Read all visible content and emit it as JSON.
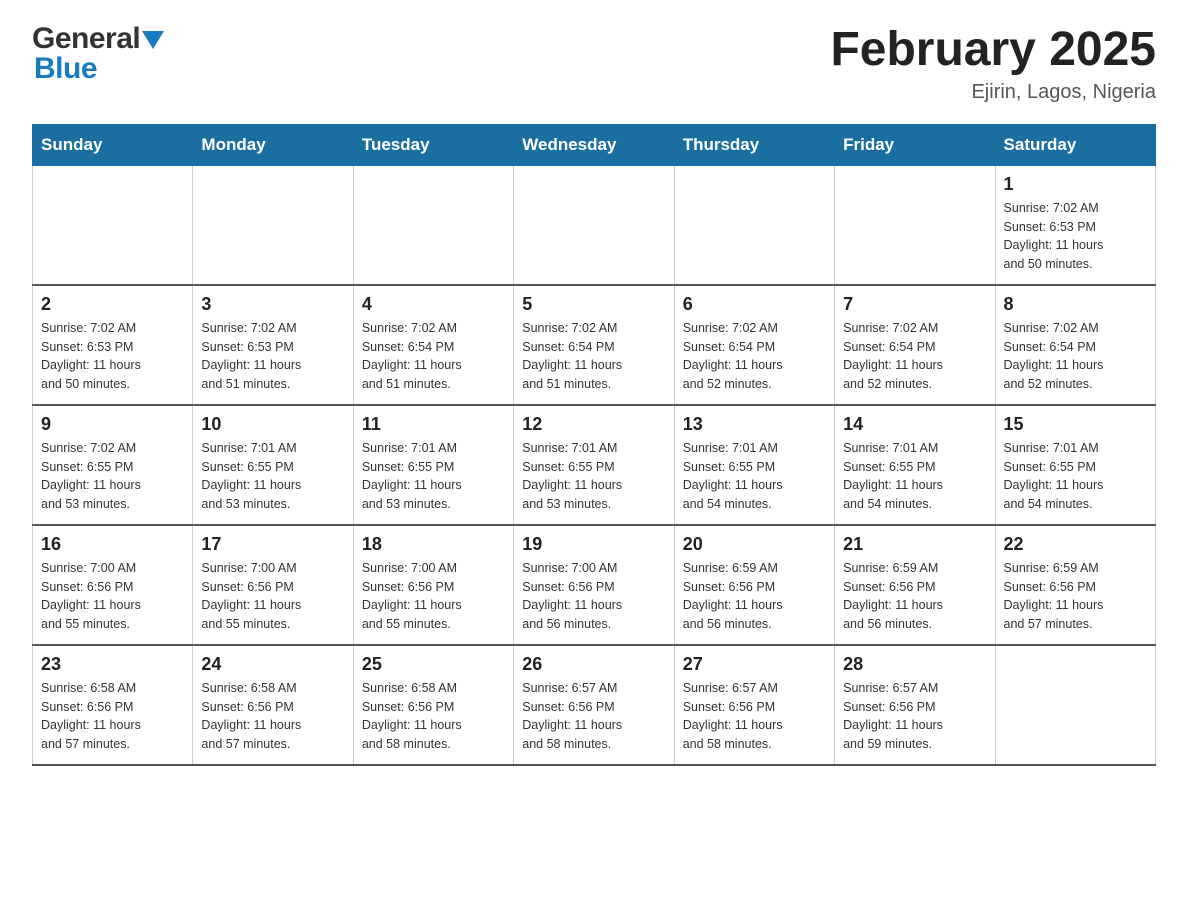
{
  "header": {
    "logo_general": "General",
    "logo_blue": "Blue",
    "month_title": "February 2025",
    "location": "Ejirin, Lagos, Nigeria"
  },
  "calendar": {
    "days_of_week": [
      "Sunday",
      "Monday",
      "Tuesday",
      "Wednesday",
      "Thursday",
      "Friday",
      "Saturday"
    ],
    "weeks": [
      {
        "days": [
          {
            "number": "",
            "info": ""
          },
          {
            "number": "",
            "info": ""
          },
          {
            "number": "",
            "info": ""
          },
          {
            "number": "",
            "info": ""
          },
          {
            "number": "",
            "info": ""
          },
          {
            "number": "",
            "info": ""
          },
          {
            "number": "1",
            "info": "Sunrise: 7:02 AM\nSunset: 6:53 PM\nDaylight: 11 hours\nand 50 minutes."
          }
        ]
      },
      {
        "days": [
          {
            "number": "2",
            "info": "Sunrise: 7:02 AM\nSunset: 6:53 PM\nDaylight: 11 hours\nand 50 minutes."
          },
          {
            "number": "3",
            "info": "Sunrise: 7:02 AM\nSunset: 6:53 PM\nDaylight: 11 hours\nand 51 minutes."
          },
          {
            "number": "4",
            "info": "Sunrise: 7:02 AM\nSunset: 6:54 PM\nDaylight: 11 hours\nand 51 minutes."
          },
          {
            "number": "5",
            "info": "Sunrise: 7:02 AM\nSunset: 6:54 PM\nDaylight: 11 hours\nand 51 minutes."
          },
          {
            "number": "6",
            "info": "Sunrise: 7:02 AM\nSunset: 6:54 PM\nDaylight: 11 hours\nand 52 minutes."
          },
          {
            "number": "7",
            "info": "Sunrise: 7:02 AM\nSunset: 6:54 PM\nDaylight: 11 hours\nand 52 minutes."
          },
          {
            "number": "8",
            "info": "Sunrise: 7:02 AM\nSunset: 6:54 PM\nDaylight: 11 hours\nand 52 minutes."
          }
        ]
      },
      {
        "days": [
          {
            "number": "9",
            "info": "Sunrise: 7:02 AM\nSunset: 6:55 PM\nDaylight: 11 hours\nand 53 minutes."
          },
          {
            "number": "10",
            "info": "Sunrise: 7:01 AM\nSunset: 6:55 PM\nDaylight: 11 hours\nand 53 minutes."
          },
          {
            "number": "11",
            "info": "Sunrise: 7:01 AM\nSunset: 6:55 PM\nDaylight: 11 hours\nand 53 minutes."
          },
          {
            "number": "12",
            "info": "Sunrise: 7:01 AM\nSunset: 6:55 PM\nDaylight: 11 hours\nand 53 minutes."
          },
          {
            "number": "13",
            "info": "Sunrise: 7:01 AM\nSunset: 6:55 PM\nDaylight: 11 hours\nand 54 minutes."
          },
          {
            "number": "14",
            "info": "Sunrise: 7:01 AM\nSunset: 6:55 PM\nDaylight: 11 hours\nand 54 minutes."
          },
          {
            "number": "15",
            "info": "Sunrise: 7:01 AM\nSunset: 6:55 PM\nDaylight: 11 hours\nand 54 minutes."
          }
        ]
      },
      {
        "days": [
          {
            "number": "16",
            "info": "Sunrise: 7:00 AM\nSunset: 6:56 PM\nDaylight: 11 hours\nand 55 minutes."
          },
          {
            "number": "17",
            "info": "Sunrise: 7:00 AM\nSunset: 6:56 PM\nDaylight: 11 hours\nand 55 minutes."
          },
          {
            "number": "18",
            "info": "Sunrise: 7:00 AM\nSunset: 6:56 PM\nDaylight: 11 hours\nand 55 minutes."
          },
          {
            "number": "19",
            "info": "Sunrise: 7:00 AM\nSunset: 6:56 PM\nDaylight: 11 hours\nand 56 minutes."
          },
          {
            "number": "20",
            "info": "Sunrise: 6:59 AM\nSunset: 6:56 PM\nDaylight: 11 hours\nand 56 minutes."
          },
          {
            "number": "21",
            "info": "Sunrise: 6:59 AM\nSunset: 6:56 PM\nDaylight: 11 hours\nand 56 minutes."
          },
          {
            "number": "22",
            "info": "Sunrise: 6:59 AM\nSunset: 6:56 PM\nDaylight: 11 hours\nand 57 minutes."
          }
        ]
      },
      {
        "days": [
          {
            "number": "23",
            "info": "Sunrise: 6:58 AM\nSunset: 6:56 PM\nDaylight: 11 hours\nand 57 minutes."
          },
          {
            "number": "24",
            "info": "Sunrise: 6:58 AM\nSunset: 6:56 PM\nDaylight: 11 hours\nand 57 minutes."
          },
          {
            "number": "25",
            "info": "Sunrise: 6:58 AM\nSunset: 6:56 PM\nDaylight: 11 hours\nand 58 minutes."
          },
          {
            "number": "26",
            "info": "Sunrise: 6:57 AM\nSunset: 6:56 PM\nDaylight: 11 hours\nand 58 minutes."
          },
          {
            "number": "27",
            "info": "Sunrise: 6:57 AM\nSunset: 6:56 PM\nDaylight: 11 hours\nand 58 minutes."
          },
          {
            "number": "28",
            "info": "Sunrise: 6:57 AM\nSunset: 6:56 PM\nDaylight: 11 hours\nand 59 minutes."
          },
          {
            "number": "",
            "info": ""
          }
        ]
      }
    ]
  }
}
